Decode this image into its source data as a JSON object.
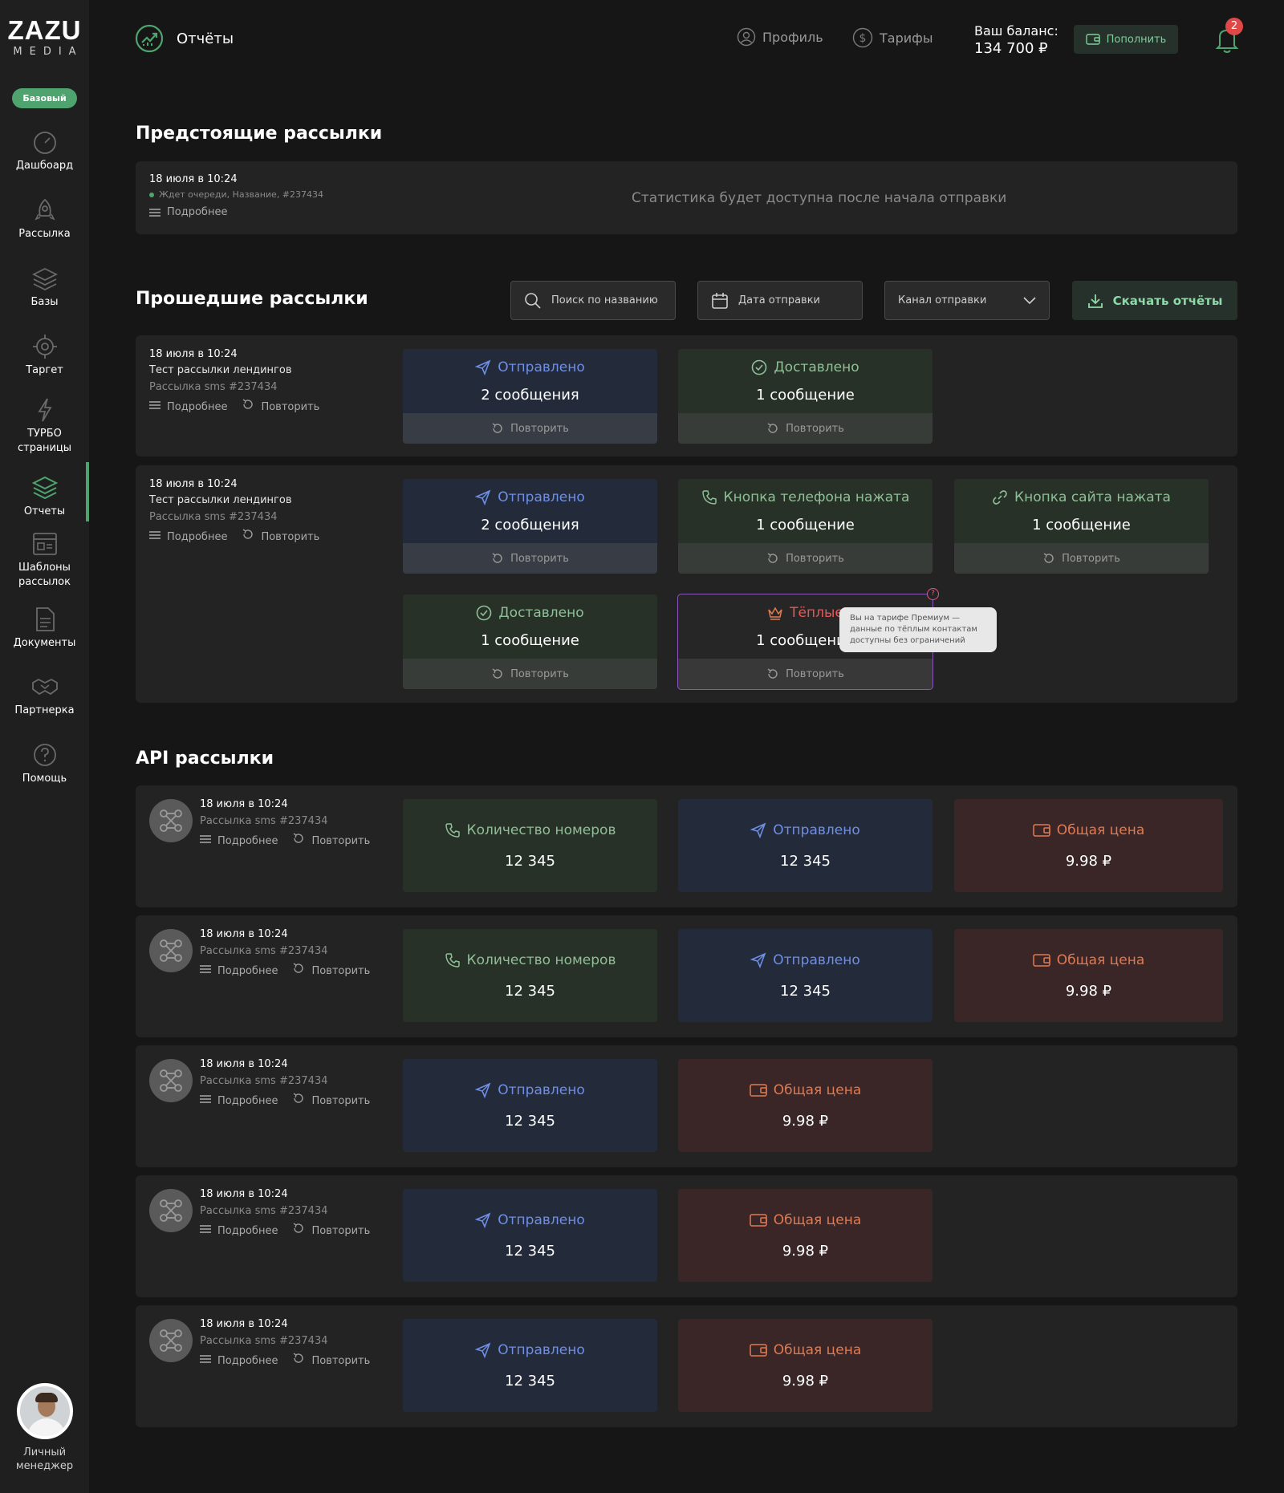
{
  "brand": {
    "line1": "ZAZU",
    "line2": "MEDIA",
    "plan": "Базовый"
  },
  "sidebar": {
    "items": [
      {
        "label": "Дашбоард",
        "icon": "gauge-icon"
      },
      {
        "label": "Рассылка",
        "icon": "rocket-icon"
      },
      {
        "label": "Базы",
        "icon": "layers-icon"
      },
      {
        "label": "Таргет",
        "icon": "target-icon"
      },
      {
        "label": "ТУРБО\nстраницы",
        "icon": "lightning-icon"
      },
      {
        "label": "Отчеты",
        "icon": "stack-icon"
      },
      {
        "label": "Шаблоны\nрассылок",
        "icon": "template-icon"
      },
      {
        "label": "Документы",
        "icon": "document-icon"
      },
      {
        "label": "Партнерка",
        "icon": "handshake-icon"
      },
      {
        "label": "Помощь",
        "icon": "help-icon"
      }
    ],
    "active": "Отчеты",
    "manager_label": "Личный\nменеджер"
  },
  "header": {
    "title": "Отчёты",
    "profile": "Профиль",
    "tariffs": "Тарифы",
    "balance_label": "Ваш баланс:",
    "balance_value": "134 700 ₽",
    "topup": "Пополнить",
    "notifications": "2"
  },
  "upcoming": {
    "title": "Предстоящие рассылки",
    "date": "18 июля в 10:24",
    "status": "Ждет очереди,  Название,  #237434",
    "more": "Подробнее",
    "message": "Статистика будет доступна после начала отправки"
  },
  "past": {
    "title": "Прошедшие рассылки",
    "search_placeholder": "Поиск по названию",
    "date_filter": "Дата отправки",
    "channel_filter": "Канал отправки",
    "download": "Скачать отчёты",
    "more": "Подробнее",
    "repeat": "Повторить",
    "cards": [
      {
        "date": "18 июля в 10:24",
        "name": "Тест рассылки лендингов",
        "sub": "Рассылка sms #237434",
        "tiles": [
          {
            "label": "Отправлено",
            "value": "2 сообщения",
            "kind": "blue",
            "icon": "send-icon"
          },
          {
            "label": "Доставлено",
            "value": "1 сообщение",
            "kind": "green",
            "icon": "check-circle-icon"
          }
        ]
      },
      {
        "date": "18 июля в 10:24",
        "name": "Тест рассылки лендингов",
        "sub": "Рассылка sms #237434",
        "tiles": [
          {
            "label": "Отправлено",
            "value": "2 сообщения",
            "kind": "blue",
            "icon": "send-icon"
          },
          {
            "label": "Кнопка телефона нажата",
            "value": "1 сообщение",
            "kind": "green",
            "icon": "phone-icon"
          },
          {
            "label": "Кнопка сайта нажата",
            "value": "1 сообщение",
            "kind": "green",
            "icon": "link-icon"
          },
          {
            "label": "Доставлено",
            "value": "1 сообщение",
            "kind": "green",
            "icon": "check-circle-icon"
          },
          {
            "label": "Тёплые",
            "value": "1 сообщение",
            "kind": "purple",
            "icon": "crown-icon"
          }
        ]
      }
    ],
    "tooltip": "Вы на тарифе Премиум — данные по тёплым контактам доступны без ограничений"
  },
  "api": {
    "title": "API рассылки",
    "cards": [
      {
        "date": "18 июля в 10:24",
        "sub": "Рассылка sms #237434",
        "tiles": [
          {
            "label": "Количество номеров",
            "value": "12 345",
            "kind": "green",
            "icon": "phone-icon"
          },
          {
            "label": "Отправлено",
            "value": "12 345",
            "kind": "blue",
            "icon": "send-icon"
          },
          {
            "label": "Общая цена",
            "value": "9.98 ₽",
            "kind": "red",
            "icon": "wallet-icon"
          }
        ]
      },
      {
        "date": "18 июля в 10:24",
        "sub": "Рассылка sms #237434",
        "tiles": [
          {
            "label": "Количество номеров",
            "value": "12 345",
            "kind": "green",
            "icon": "phone-icon"
          },
          {
            "label": "Отправлено",
            "value": "12 345",
            "kind": "blue",
            "icon": "send-icon"
          },
          {
            "label": "Общая цена",
            "value": "9.98 ₽",
            "kind": "red",
            "icon": "wallet-icon"
          }
        ]
      },
      {
        "date": "18 июля в 10:24",
        "sub": "Рассылка sms #237434",
        "tiles": [
          {
            "label": "Отправлено",
            "value": "12 345",
            "kind": "blue",
            "icon": "send-icon"
          },
          {
            "label": "Общая цена",
            "value": "9.98 ₽",
            "kind": "red",
            "icon": "wallet-icon"
          }
        ]
      },
      {
        "date": "18 июля в 10:24",
        "sub": "Рассылка sms #237434",
        "tiles": [
          {
            "label": "Отправлено",
            "value": "12 345",
            "kind": "blue",
            "icon": "send-icon"
          },
          {
            "label": "Общая цена",
            "value": "9.98 ₽",
            "kind": "red",
            "icon": "wallet-icon"
          }
        ]
      },
      {
        "date": "18 июля в 10:24",
        "sub": "Рассылка sms #237434",
        "tiles": [
          {
            "label": "Отправлено",
            "value": "12 345",
            "kind": "blue",
            "icon": "send-icon"
          },
          {
            "label": "Общая цена",
            "value": "9.98 ₽",
            "kind": "red",
            "icon": "wallet-icon"
          }
        ]
      }
    ]
  },
  "colors": {
    "accent": "#4fa36f",
    "blue": "#6f8fe6",
    "green": "#8fbf96",
    "red": "#e07a52",
    "purple": "#8a57b8"
  }
}
